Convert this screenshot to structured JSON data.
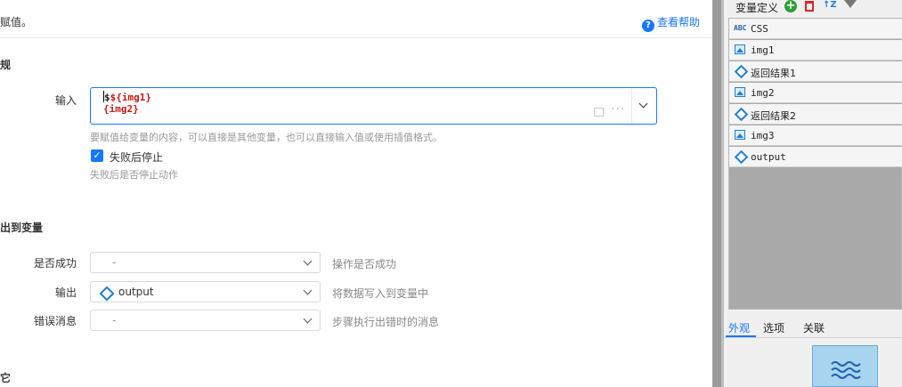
{
  "header": {
    "desc_tail": "赋值。",
    "help_link": "查看帮助",
    "help_icon_glyph": "?"
  },
  "section_rule": {
    "title": "规"
  },
  "input_field": {
    "label": "输入",
    "line1_prefix": "$",
    "line1_var": "${img1}",
    "line2_var": "{img2}",
    "hint": "要赋值给变量的内容，可以直接是其他变量，也可以直接输入值或使用插值格式。"
  },
  "stop_on_fail": {
    "checked": true,
    "label": "失败后停止",
    "hint": "失败后是否停止动作"
  },
  "section_output": {
    "title": "出到变量"
  },
  "outputs": [
    {
      "label": "是否成功",
      "value": "-",
      "hint": "操作是否成功",
      "has_icon": false
    },
    {
      "label": "输出",
      "value": "output",
      "hint": "将数据写入到变量中",
      "has_icon": true
    },
    {
      "label": "错误消息",
      "value": "-",
      "hint": "步骤执行出错时的消息",
      "has_icon": false
    }
  ],
  "section_other": {
    "title": "它"
  },
  "right_panel": {
    "toolbar_title": "变量定义",
    "variables": [
      {
        "name": "CSS",
        "type": "text",
        "type_label": "ABC"
      },
      {
        "name": "img1",
        "type": "image"
      },
      {
        "name": "返回结果1",
        "type": "object"
      },
      {
        "name": "img2",
        "type": "image"
      },
      {
        "name": "返回结果2",
        "type": "object"
      },
      {
        "name": "img3",
        "type": "image"
      },
      {
        "name": "output",
        "type": "object"
      }
    ],
    "tabs": [
      {
        "label": "外观",
        "active": true
      },
      {
        "label": "选项",
        "active": false
      },
      {
        "label": "关联",
        "active": false
      }
    ]
  },
  "colors": {
    "accent": "#1677ff",
    "input_code": "#c41a16"
  }
}
